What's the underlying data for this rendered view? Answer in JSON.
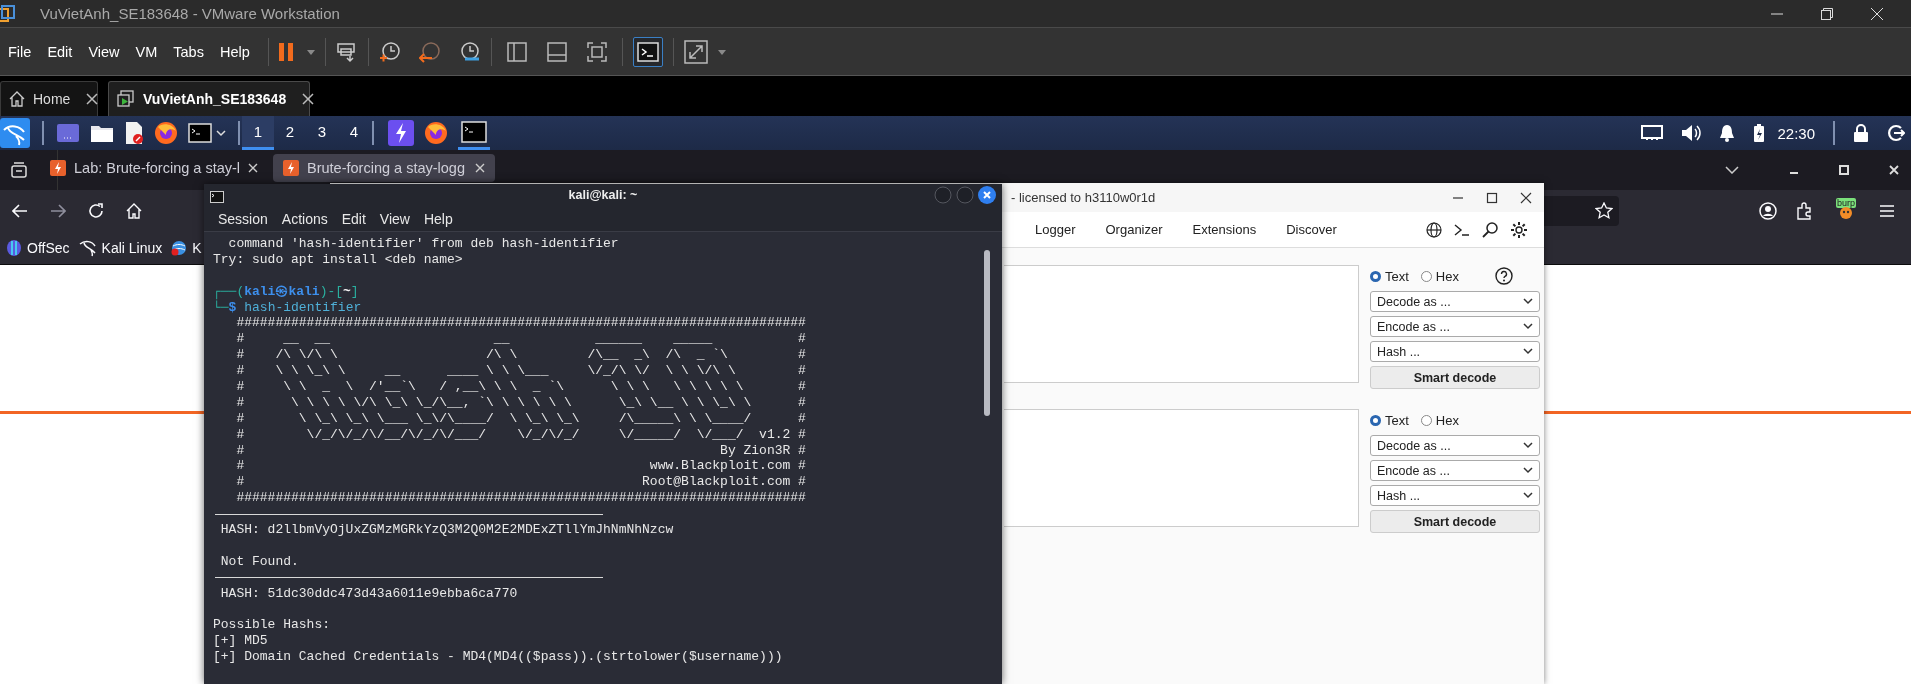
{
  "vmware": {
    "title": "VuVietAnh_SE183648 - VMware Workstation",
    "menu": [
      "File",
      "Edit",
      "View",
      "VM",
      "Tabs",
      "Help"
    ],
    "view_buttons": [
      {
        "selected": false
      },
      {
        "selected": false
      },
      {
        "selected": false
      },
      {
        "selected": true
      }
    ],
    "tabs": [
      {
        "label": "Home",
        "selected": false
      },
      {
        "label": "VuVietAnh_SE183648",
        "selected": true
      }
    ]
  },
  "kali_panel": {
    "workspaces": [
      {
        "label": "1",
        "selected": true
      },
      {
        "label": "2",
        "selected": false
      },
      {
        "label": "3",
        "selected": false
      },
      {
        "label": "4",
        "selected": false
      }
    ],
    "clock": "22:30"
  },
  "firefox": {
    "tabs": [
      {
        "label": "Lab: Brute-forcing a stay-l",
        "selected": false
      },
      {
        "label": "Brute-forcing a stay-logg",
        "selected": true
      }
    ],
    "bookmarks": [
      "OffSec",
      "Kali Linux",
      "K"
    ],
    "extension_badge": "burp"
  },
  "burp": {
    "title": "- licensed to h3110w0r1d",
    "tabs": [
      "Logger",
      "Organizer",
      "Extensions",
      "Discover"
    ],
    "decoders": [
      {
        "formats": [
          {
            "label": "Text",
            "selected": true
          },
          {
            "label": "Hex",
            "selected": false
          }
        ],
        "help": true,
        "dropdowns": [
          "Decode as ...",
          "Encode as ...",
          "Hash ..."
        ],
        "button": "Smart decode"
      },
      {
        "formats": [
          {
            "label": "Text",
            "selected": true
          },
          {
            "label": "Hex",
            "selected": false
          }
        ],
        "help": false,
        "dropdowns": [
          "Decode as ...",
          "Encode as ...",
          "Hash ..."
        ],
        "button": "Smart decode"
      }
    ]
  },
  "terminal": {
    "title": "kali@kali: ~",
    "menu": [
      "Session",
      "Actions",
      "Edit",
      "View",
      "Help"
    ],
    "lines": [
      {
        "kind": "output",
        "text": "  command 'hash-identifier' from deb hash-identifier"
      },
      {
        "kind": "output",
        "text": "Try: sudo apt install <deb name>"
      },
      {
        "kind": "blank"
      },
      {
        "kind": "prompt",
        "segments": [
          {
            "kind": "frame",
            "text": "┌──("
          },
          {
            "kind": "user",
            "text": "kali㉿kali"
          },
          {
            "kind": "frame",
            "text": ")-["
          },
          {
            "kind": "dir",
            "text": "~"
          },
          {
            "kind": "frame",
            "text": "]"
          }
        ]
      },
      {
        "kind": "prompt",
        "segments": [
          {
            "kind": "frame",
            "text": "└─"
          },
          {
            "kind": "user",
            "text": "$"
          },
          {
            "kind": "command",
            "text": " hash-identifier"
          }
        ]
      },
      {
        "kind": "output",
        "text": "   #########################################################################"
      },
      {
        "kind": "output",
        "text": "   #     __  __                     __           ______    _____           #"
      },
      {
        "kind": "output",
        "text": "   #    /\\ \\/\\ \\                   /\\ \\         /\\__  _\\  /\\  _ `\\         #"
      },
      {
        "kind": "output",
        "text": "   #    \\ \\ \\_\\ \\     __      ____ \\ \\ \\___     \\/_/\\ \\/  \\ \\ \\/\\ \\        #"
      },
      {
        "kind": "output",
        "text": "   #     \\ \\  _  \\  /'__`\\   / ,__\\ \\ \\  _ `\\      \\ \\ \\   \\ \\ \\ \\ \\       #"
      },
      {
        "kind": "output",
        "text": "   #      \\ \\ \\ \\ \\/\\ \\_\\ \\_/\\__, `\\ \\ \\ \\ \\ \\      \\_\\ \\__ \\ \\ \\_\\ \\      #"
      },
      {
        "kind": "output",
        "text": "   #       \\ \\_\\ \\_\\ \\___ \\_\\/\\____/  \\ \\_\\ \\_\\     /\\_____\\ \\ \\____/      #"
      },
      {
        "kind": "output",
        "text": "   #        \\/_/\\/_/\\/__/\\/_/\\/___/    \\/_/\\/_/     \\/_____/  \\/___/  v1.2 #"
      },
      {
        "kind": "output",
        "text": "   #                                                             By Zion3R #"
      },
      {
        "kind": "output",
        "text": "   #                                                    www.Blackploit.com #"
      },
      {
        "kind": "output",
        "text": "   #                                                   Root@Blackploit.com #"
      },
      {
        "kind": "output",
        "text": "   #########################################################################"
      },
      {
        "kind": "rule"
      },
      {
        "kind": "output",
        "text": " HASH: d2llbmVyOjUxZGMzMGRkYzQ3M2Q0M2E2MDExZTllYmJhNmNhNzcw"
      },
      {
        "kind": "blank"
      },
      {
        "kind": "output",
        "text": " Not Found."
      },
      {
        "kind": "rule"
      },
      {
        "kind": "output",
        "text": " HASH: 51dc30ddc473d43a6011e9ebba6ca770"
      },
      {
        "kind": "blank"
      },
      {
        "kind": "output",
        "text": "Possible Hashs:"
      },
      {
        "kind": "output",
        "text": "[+] MD5"
      },
      {
        "kind": "output",
        "text": "[+] Domain Cached Credentials - MD4(MD4(($pass)).(strtolower($username)))"
      }
    ]
  }
}
